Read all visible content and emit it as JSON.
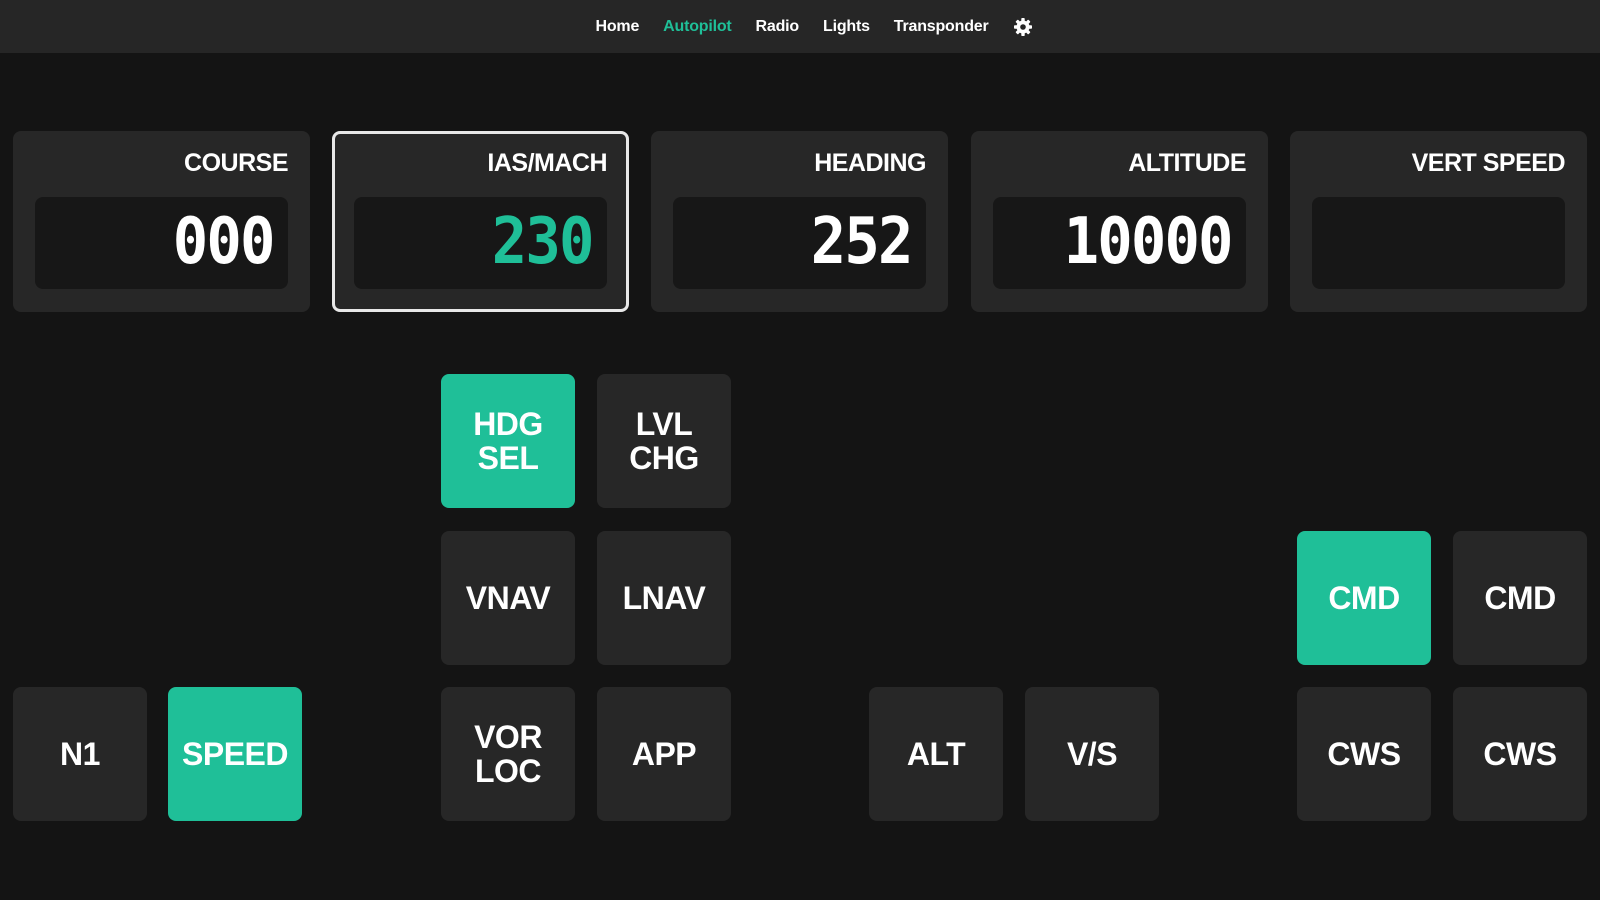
{
  "nav": {
    "items": [
      "Home",
      "Autopilot",
      "Radio",
      "Lights",
      "Transponder"
    ],
    "active_index": 1,
    "settings_icon": "gear-icon"
  },
  "displays": {
    "course": {
      "label": "COURSE",
      "value": "000"
    },
    "ias_mach": {
      "label": "IAS/MACH",
      "value": "230"
    },
    "heading": {
      "label": "HEADING",
      "value": "252"
    },
    "altitude": {
      "label": "ALTITUDE",
      "value": "10000"
    },
    "vert_speed": {
      "label": "VERT SPEED",
      "value": ""
    }
  },
  "buttons": {
    "hdg_sel": {
      "label": "HDG\nSEL",
      "active": true
    },
    "lvl_chg": {
      "label": "LVL\nCHG",
      "active": false
    },
    "vnav": {
      "label": "VNAV",
      "active": false
    },
    "lnav": {
      "label": "LNAV",
      "active": false
    },
    "cmd_a": {
      "label": "CMD",
      "active": true
    },
    "cmd_b": {
      "label": "CMD",
      "active": false
    },
    "n1": {
      "label": "N1",
      "active": false
    },
    "speed": {
      "label": "SPEED",
      "active": true
    },
    "vor_loc": {
      "label": "VOR\nLOC",
      "active": false
    },
    "app": {
      "label": "APP",
      "active": false
    },
    "alt": {
      "label": "ALT",
      "active": false
    },
    "vs": {
      "label": "V/S",
      "active": false
    },
    "cws_a": {
      "label": "CWS",
      "active": false
    },
    "cws_b": {
      "label": "CWS",
      "active": false
    }
  },
  "colors": {
    "accent": "#1fbf98",
    "background": "#141414",
    "panel": "#272727",
    "nav_bar": "#262626"
  }
}
